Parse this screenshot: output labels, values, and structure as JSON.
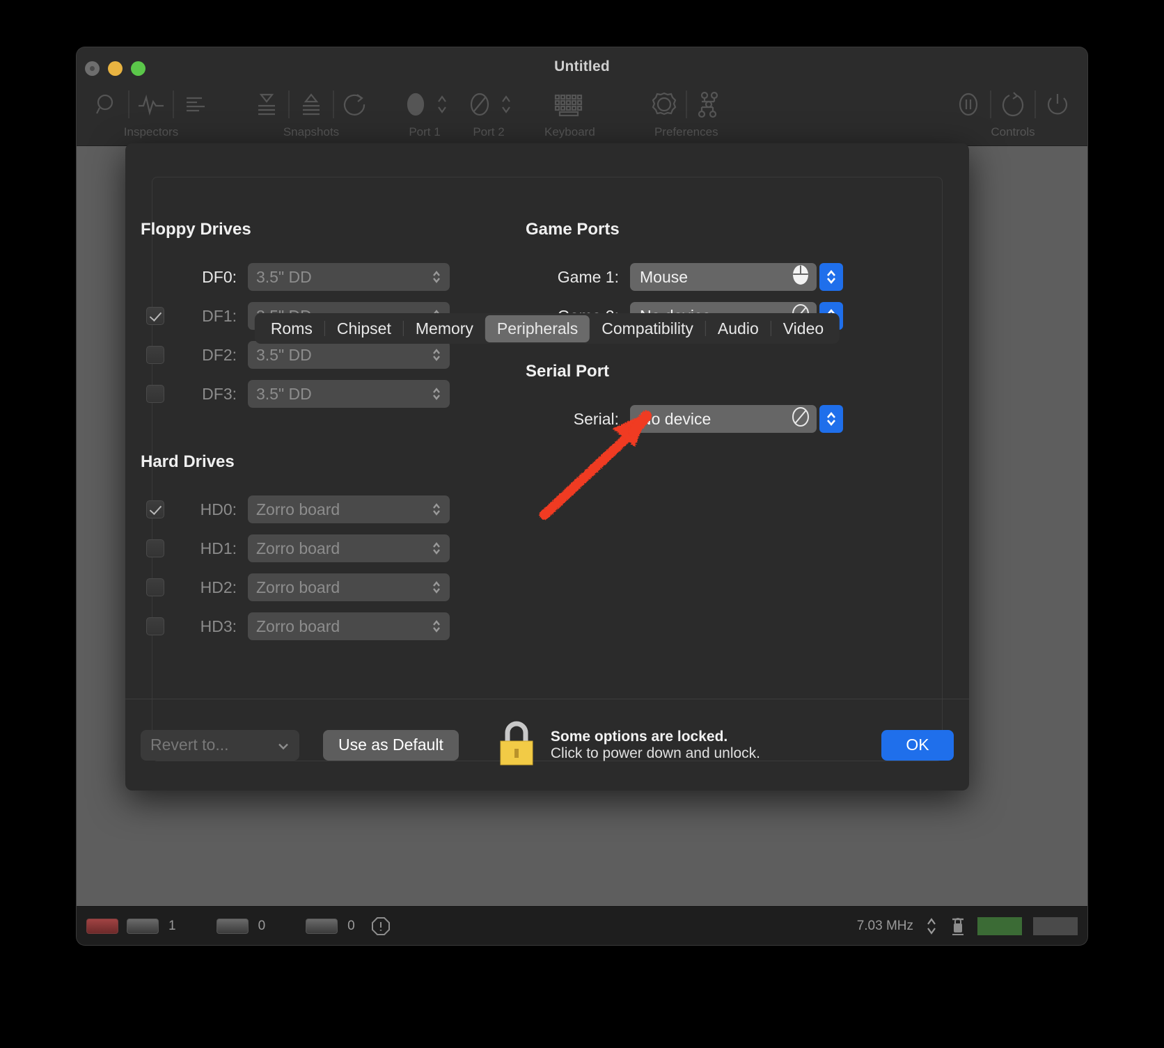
{
  "window": {
    "title": "Untitled",
    "traffic": {
      "close": "close-button",
      "minimize": "minimize-button",
      "zoom": "zoom-button"
    },
    "toolbar": [
      {
        "label": "Inspectors",
        "icons": [
          "magnifier-icon",
          "waveform-icon",
          "list-icon"
        ]
      },
      {
        "label": "Snapshots",
        "icons": [
          "save-snapshot-icon",
          "restore-snapshot-icon",
          "revert-icon"
        ]
      },
      {
        "label": "Port 1",
        "icons": [
          "mouse-icon",
          "updown-chevron-icon"
        ]
      },
      {
        "label": "Port 2",
        "icons": [
          "no-device-icon",
          "updown-chevron-icon"
        ]
      },
      {
        "label": "Keyboard",
        "icons": [
          "keyboard-icon"
        ]
      },
      {
        "label": "Preferences",
        "icons": [
          "gear-icon",
          "config-nodes-icon"
        ]
      },
      {
        "label": "Controls",
        "icons": [
          "pause-icon",
          "reset-icon",
          "power-icon"
        ]
      }
    ]
  },
  "statusbar": {
    "df_value": "1",
    "hd_value": "0",
    "other_value": "0",
    "warn_icon": "warning-octagon-icon",
    "clock": "7.03 MHz",
    "stepper_icon": "updown-chevron-icon",
    "lock_icon": "lock-icon",
    "power_led_color": "#3b6b35"
  },
  "sheet": {
    "tabs": [
      {
        "label": "Roms",
        "active": false
      },
      {
        "label": "Chipset",
        "active": false
      },
      {
        "label": "Memory",
        "active": false
      },
      {
        "label": "Peripherals",
        "active": true
      },
      {
        "label": "Compatibility",
        "active": false
      },
      {
        "label": "Audio",
        "active": false
      },
      {
        "label": "Video",
        "active": false
      }
    ],
    "floppy": {
      "title": "Floppy Drives",
      "rows": [
        {
          "label": "DF0:",
          "value": "3.5\" DD",
          "checkbox": null,
          "checked": false
        },
        {
          "label": "DF1:",
          "value": "3.5\" DD",
          "checkbox": true,
          "checked": true
        },
        {
          "label": "DF2:",
          "value": "3.5\" DD",
          "checkbox": true,
          "checked": false
        },
        {
          "label": "DF3:",
          "value": "3.5\" DD",
          "checkbox": true,
          "checked": false
        }
      ]
    },
    "harddrives": {
      "title": "Hard Drives",
      "rows": [
        {
          "label": "HD0:",
          "value": "Zorro board",
          "checkbox": true,
          "checked": true
        },
        {
          "label": "HD1:",
          "value": "Zorro board",
          "checkbox": true,
          "checked": false
        },
        {
          "label": "HD2:",
          "value": "Zorro board",
          "checkbox": true,
          "checked": false
        },
        {
          "label": "HD3:",
          "value": "Zorro board",
          "checkbox": true,
          "checked": false
        }
      ]
    },
    "gameports": {
      "title": "Game Ports",
      "rows": [
        {
          "label": "Game 1:",
          "value": "Mouse",
          "icon": "mouse-icon"
        },
        {
          "label": "Game 2:",
          "value": "No device",
          "icon": "no-device-icon"
        }
      ]
    },
    "serialport": {
      "title": "Serial Port",
      "rows": [
        {
          "label": "Serial:",
          "value": "No device",
          "icon": "no-device-icon"
        }
      ]
    },
    "footer": {
      "revert_label": "Revert to...",
      "use_default_label": "Use as Default",
      "lock_icon": "padlock-icon",
      "lock_line1": "Some options are locked.",
      "lock_line2": "Click to power down and unlock.",
      "ok_label": "OK"
    }
  },
  "annotation": {
    "type": "arrow",
    "color": "#f03a20"
  },
  "colors": {
    "accent_blue": "#1f6feb",
    "lock_yellow": "#f2cb46",
    "annotation_red": "#f03a20",
    "window_bg": "#2a2a2a",
    "sheet_bg": "#2b2b2b"
  }
}
